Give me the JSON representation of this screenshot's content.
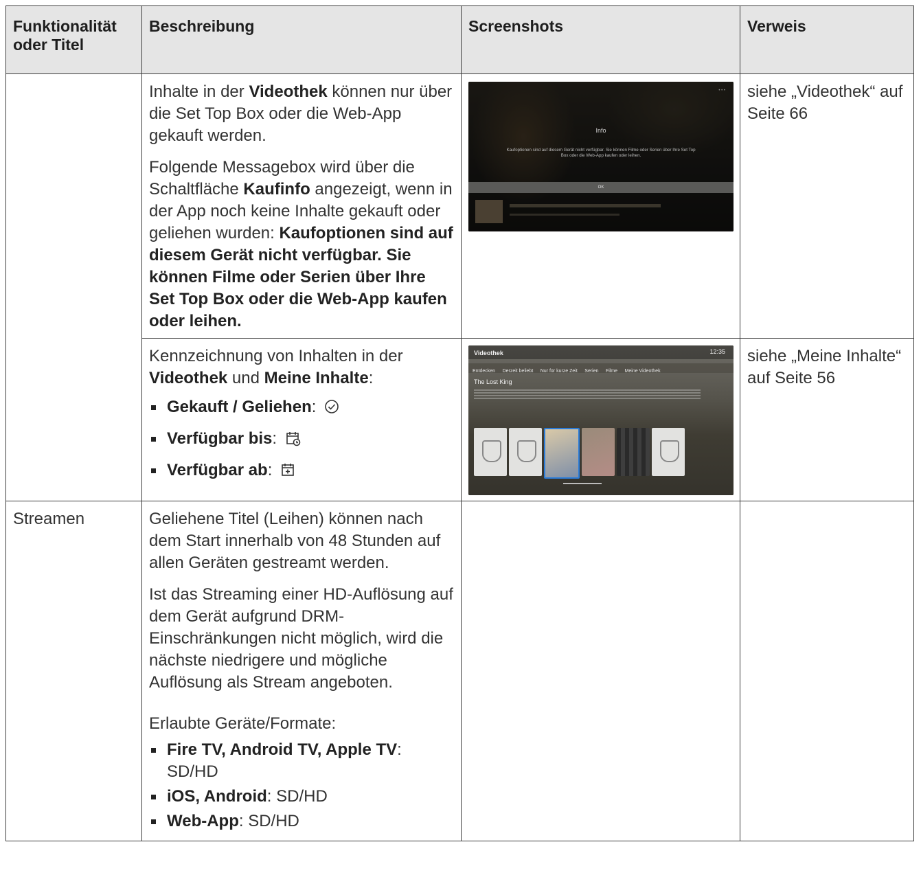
{
  "headers": {
    "col1": "Funktionalität oder Titel",
    "col2": "Beschreibung",
    "col3": "Screenshots",
    "col4": "Verweis"
  },
  "row1": {
    "p1_pre": "Inhalte in der ",
    "p1_bold": "Videothek",
    "p1_post": " können nur über die Set Top Box oder die Web-App gekauft werden.",
    "p2_pre": "Folgende Messagebox wird über die Schaltfläche ",
    "p2_bold": "Kaufinfo",
    "p2_mid": " angezeigt, wenn in der App noch keine Inhalte gekauft oder geliehen wurden: ",
    "p2_bold2": "Kaufoptionen sind auf diesem Gerät nicht verfügbar. Sie können Filme oder Serien über Ihre Set Top Box oder die Web-App kaufen oder leihen.",
    "ref": "siehe „Videothek“ auf Seite 66",
    "screenshot": {
      "title": "Info",
      "message": "Kaufoptionen sind auf diesem Gerät nicht verfügbar. Sie können Filme oder Serien über Ihre Set Top Box oder die Web-App kaufen oder leihen.",
      "button": "OK"
    }
  },
  "row2": {
    "intro_pre": "Kennzeichnung von Inhalten in der ",
    "intro_bold1": "Videothek",
    "intro_mid": " und ",
    "intro_bold2": "Meine Inhalte",
    "intro_post": ":",
    "items": [
      {
        "label": "Gekauft / Geliehen",
        "sep": ":",
        "icon": "check-circle-icon"
      },
      {
        "label": "Verfügbar bis",
        "sep": ":",
        "icon": "calendar-clock-icon"
      },
      {
        "label": "Verfügbar ab",
        "sep": ":",
        "icon": "calendar-plus-icon"
      }
    ],
    "ref": "siehe „Meine Inhalte“ auf Seite 56",
    "screenshot": {
      "logo": "Videothek",
      "clock": "12:35",
      "nav": [
        "Entdecken",
        "Derzeit beliebt",
        "Nur für kurze Zeit",
        "Serien",
        "Filme",
        "Meine Videothek"
      ],
      "title": "The Lost King"
    }
  },
  "row3": {
    "title": "Streamen",
    "p1": "Geliehene Titel (Leihen) können nach dem Start innerhalb von 48 Stunden auf allen Geräten gestreamt werden.",
    "p2": "Ist das Streaming einer HD-Auflösung auf dem Gerät aufgrund DRM-Einschränkungen nicht möglich, wird die nächste niedrigere und mögliche Auflösung als Stream angeboten.",
    "p3": "Erlaubte Geräte/Formate:",
    "formats": [
      {
        "device": "Fire TV, Android TV, Apple TV",
        "value": ": SD/HD"
      },
      {
        "device": "iOS, Android",
        "value": ": SD/HD"
      },
      {
        "device": "Web-App",
        "value": ": SD/HD"
      }
    ]
  }
}
